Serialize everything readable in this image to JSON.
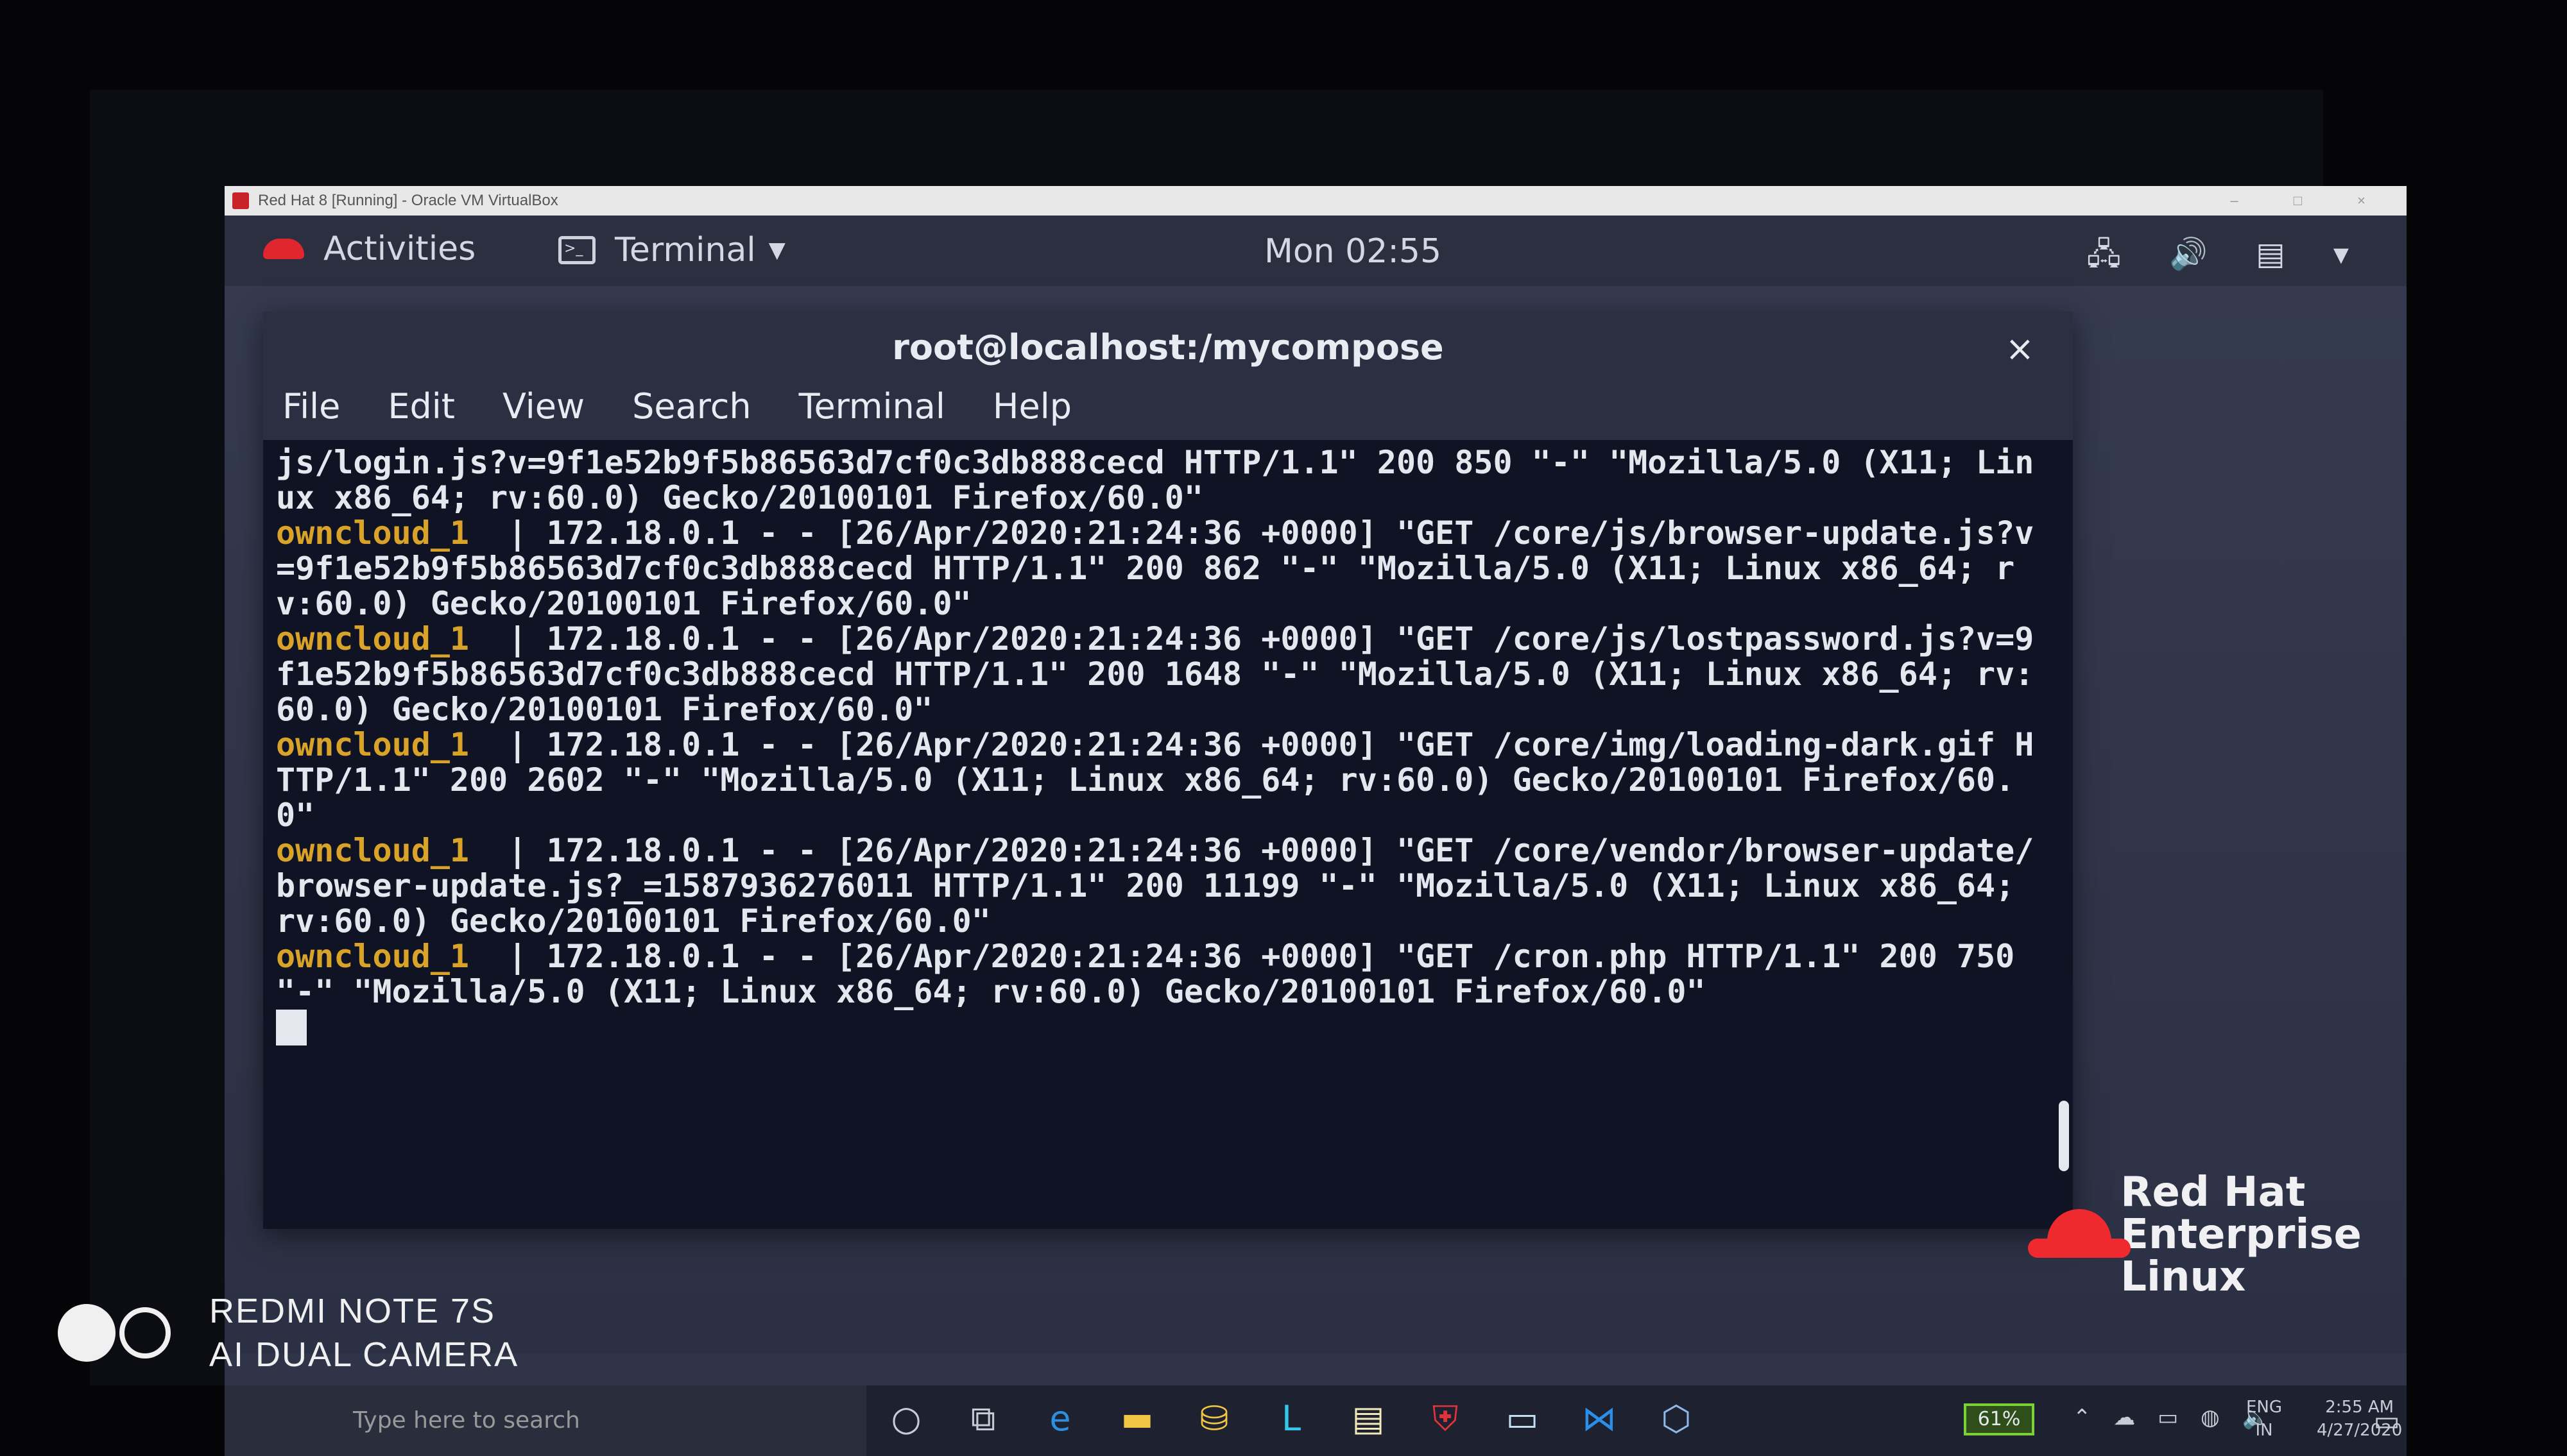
{
  "vbox": {
    "title": "Red Hat 8 [Running] - Oracle VM VirtualBox",
    "controls": "– □ ×"
  },
  "gnome": {
    "activities": "Activities",
    "app_menu": "Terminal",
    "clock": "Mon 02:55",
    "tray": "🖧 🔊 ▤ ▾"
  },
  "terminal": {
    "title": "root@localhost:/mycompose",
    "close": "×",
    "menu": [
      "File",
      "Edit",
      "View",
      "Search",
      "Terminal",
      "Help"
    ],
    "lines": [
      {
        "prefix": "",
        "text": "js/login.js?v=9f1e52b9f5b86563d7cf0c3db888cecd HTTP/1.1\" 200 850 \"-\" \"Mozilla/5.0 (X11; Linux x86_64; rv:60.0) Gecko/20100101 Firefox/60.0\""
      },
      {
        "prefix": "owncloud_1",
        "text": "  | 172.18.0.1 - - [26/Apr/2020:21:24:36 +0000] \"GET /core/js/browser-update.js?v=9f1e52b9f5b86563d7cf0c3db888cecd HTTP/1.1\" 200 862 \"-\" \"Mozilla/5.0 (X11; Linux x86_64; rv:60.0) Gecko/20100101 Firefox/60.0\""
      },
      {
        "prefix": "owncloud_1",
        "text": "  | 172.18.0.1 - - [26/Apr/2020:21:24:36 +0000] \"GET /core/js/lostpassword.js?v=9f1e52b9f5b86563d7cf0c3db888cecd HTTP/1.1\" 200 1648 \"-\" \"Mozilla/5.0 (X11; Linux x86_64; rv:60.0) Gecko/20100101 Firefox/60.0\""
      },
      {
        "prefix": "owncloud_1",
        "text": "  | 172.18.0.1 - - [26/Apr/2020:21:24:36 +0000] \"GET /core/img/loading-dark.gif HTTP/1.1\" 200 2602 \"-\" \"Mozilla/5.0 (X11; Linux x86_64; rv:60.0) Gecko/20100101 Firefox/60.0\""
      },
      {
        "prefix": "owncloud_1",
        "text": "  | 172.18.0.1 - - [26/Apr/2020:21:24:36 +0000] \"GET /core/vendor/browser-update/browser-update.js?_=1587936276011 HTTP/1.1\" 200 11199 \"-\" \"Mozilla/5.0 (X11; Linux x86_64; rv:60.0) Gecko/20100101 Firefox/60.0\""
      },
      {
        "prefix": "owncloud_1",
        "text": "  | 172.18.0.1 - - [26/Apr/2020:21:24:36 +0000] \"GET /cron.php HTTP/1.1\" 200 750 \"-\" \"Mozilla/5.0 (X11; Linux x86_64; rv:60.0) Gecko/20100101 Firefox/60.0\""
      }
    ],
    "prefix_color": "#d9a32a"
  },
  "redhat_logo": {
    "line1": "Red Hat",
    "line2": "Enterprise Linux"
  },
  "taskbar": {
    "search_placeholder": "Type here to search",
    "icons": [
      "task-view-icon",
      "edge-icon",
      "file-explorer-icon",
      "store-icon",
      "app-l-icon",
      "notes-icon",
      "mcafee-icon",
      "chat-icon",
      "vscode-icon",
      "virtualbox-icon"
    ],
    "battery": "61%",
    "lang_top": "ENG",
    "lang_bottom": "IN",
    "time": "2:55 AM",
    "date": "4/27/2020"
  },
  "watermark": {
    "line1": "REDMI NOTE 7S",
    "line2": "AI DUAL CAMERA"
  }
}
